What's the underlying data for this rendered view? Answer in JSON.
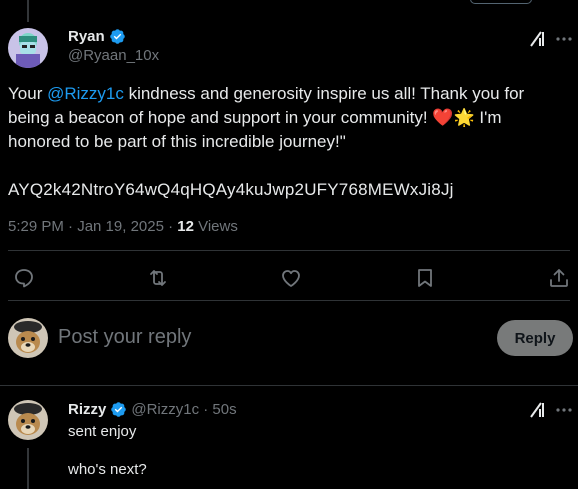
{
  "tweet": {
    "author_name": "Ryan",
    "author_handle": "@Ryaan_10x",
    "text_before": "Your ",
    "mention": "@Rizzy1c",
    "text_mid": " kindness and generosity inspire us all! Thank you for being a beacon of hope and support in your community! ",
    "emoji_heart": "❤️",
    "emoji_sun": "🌟",
    "text_after": " I'm honored to be part of this incredible journey!\"",
    "code": "AYQ2k42NtroY64wQ4qHQAy4kuJwp2UFY768MEWxJi8Jj",
    "timestamp": "5:29 PM · Jan 19, 2025 · ",
    "views_count": "12",
    "views_label": " Views"
  },
  "reply_box": {
    "placeholder": "Post your reply",
    "button_label": "Reply"
  },
  "reply": {
    "author_name": "Rizzy",
    "meta": "@Rizzy1c · 50s",
    "line1": "sent enjoy",
    "line2": "who's next?"
  },
  "colors": {
    "accent": "#1d9bf0",
    "muted": "#71767b",
    "text": "#e7e9ea",
    "background": "#000000",
    "heart": "#f91880"
  },
  "icons": [
    "verified-badge-icon",
    "grok-icon",
    "more-icon",
    "reply-icon",
    "repost-icon",
    "like-icon",
    "bookmark-icon",
    "share-icon"
  ]
}
